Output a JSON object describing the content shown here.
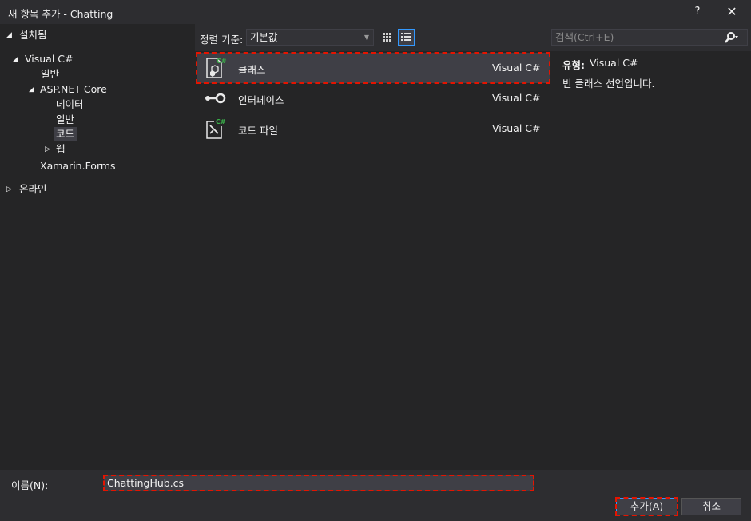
{
  "window": {
    "title": "새 항목 추가 - Chatting",
    "help": "?",
    "close": "✕"
  },
  "tree": {
    "installed": "설치됨",
    "visual_csharp": "Visual C#",
    "general": "일반",
    "aspnet_core": "ASP.NET Core",
    "data": "데이터",
    "general2": "일반",
    "code": "코드",
    "web": "웹",
    "xamarin": "Xamarin.Forms",
    "online": "온라인"
  },
  "toolbar": {
    "sort_label": "정렬 기준:",
    "sort_value": "기본값"
  },
  "search": {
    "placeholder": "검색(Ctrl+E)"
  },
  "items": [
    {
      "name": "클래스",
      "lang": "Visual C#"
    },
    {
      "name": "인터페이스",
      "lang": "Visual C#"
    },
    {
      "name": "코드 파일",
      "lang": "Visual C#"
    }
  ],
  "description": {
    "type_label": "유형:",
    "type_value": "Visual C#",
    "text": "빈 클래스 선언입니다."
  },
  "name_field": {
    "label": "이름(N):",
    "value": "ChattingHub.cs"
  },
  "buttons": {
    "add": "추가(A)",
    "cancel": "취소"
  },
  "colors": {
    "background": "#2d2d30",
    "panel": "#252526",
    "selection": "#3f3f46",
    "accent": "#3399ff",
    "highlight_border": "#e51400",
    "csharp_badge": "#3ab44a"
  }
}
